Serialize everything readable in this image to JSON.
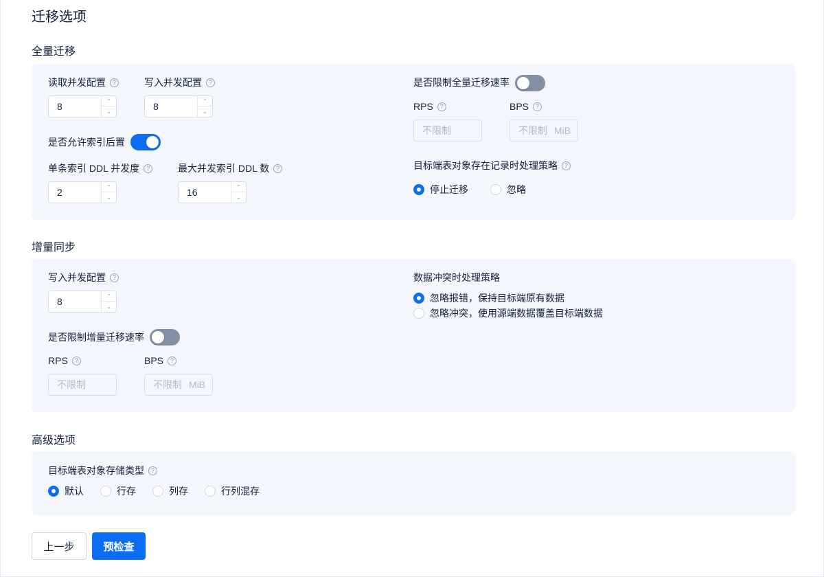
{
  "page": {
    "title": "迁移选项"
  },
  "full_migration": {
    "title": "全量迁移",
    "read_concurrency": {
      "label": "读取并发配置",
      "value": "8"
    },
    "write_concurrency": {
      "label": "写入并发配置",
      "value": "8"
    },
    "index_postpone": {
      "label": "是否允许索引后置",
      "enabled": true
    },
    "single_index_ddl": {
      "label": "单条索引 DDL 并发度",
      "value": "2"
    },
    "max_index_ddl": {
      "label": "最大并发索引 DDL 数",
      "value": "16"
    },
    "limit_rate": {
      "label": "是否限制全量迁移速率",
      "enabled": false
    },
    "rps": {
      "label": "RPS",
      "placeholder": "不限制"
    },
    "bps": {
      "label": "BPS",
      "placeholder": "不限制",
      "unit": "MiB"
    },
    "target_exists_policy": {
      "label": "目标端表对象存在记录时处理策略",
      "options": [
        "停止迁移",
        "忽略"
      ],
      "selected": "停止迁移"
    }
  },
  "incremental_sync": {
    "title": "增量同步",
    "write_concurrency": {
      "label": "写入并发配置",
      "value": "8"
    },
    "limit_rate": {
      "label": "是否限制增量迁移速率",
      "enabled": false
    },
    "rps": {
      "label": "RPS",
      "placeholder": "不限制"
    },
    "bps": {
      "label": "BPS",
      "placeholder": "不限制",
      "unit": "MiB"
    },
    "conflict_policy": {
      "label": "数据冲突时处理策略",
      "options": [
        "忽略报错，保持目标端原有数据",
        "忽略冲突，使用源端数据覆盖目标端数据"
      ],
      "selected": "忽略报错，保持目标端原有数据"
    }
  },
  "advanced": {
    "title": "高级选项",
    "storage_type": {
      "label": "目标端表对象存储类型",
      "options": [
        "默认",
        "行存",
        "列存",
        "行列混存"
      ],
      "selected": "默认"
    }
  },
  "footer": {
    "prev_label": "上一步",
    "precheck_label": "预检查"
  },
  "colors": {
    "accent": "#0c6cf2",
    "panel_bg": "#f4f7fd",
    "switch_off": "#8390a6"
  },
  "icons": {
    "help": "question-circle-icon",
    "up": "chevron-up-icon",
    "down": "chevron-down-icon"
  }
}
